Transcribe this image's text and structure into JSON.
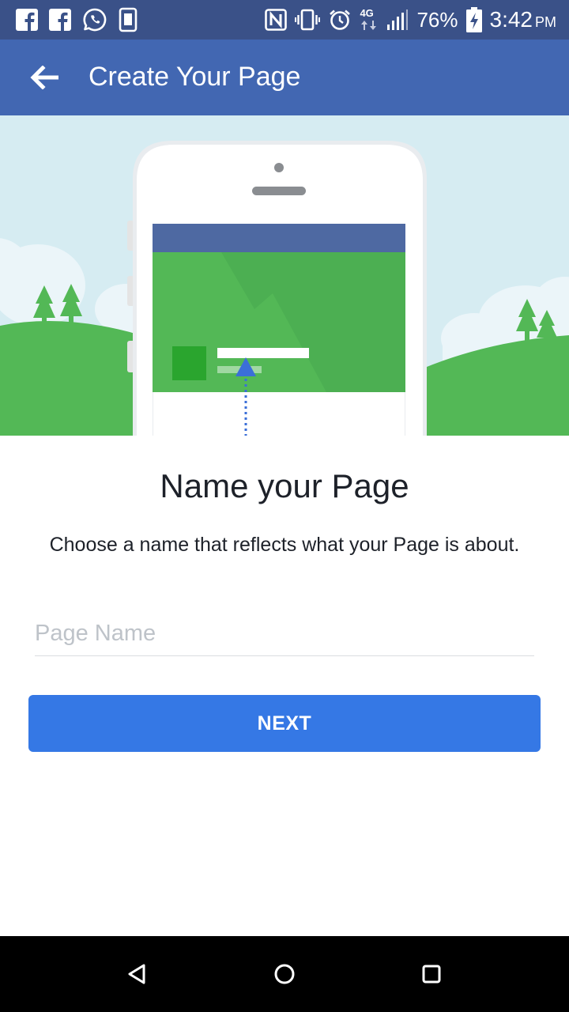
{
  "status_bar": {
    "notification_icons": [
      "facebook-icon",
      "facebook-icon",
      "whatsapp-icon",
      "screenshot-icon"
    ],
    "system_icons": [
      "nfc-icon",
      "vibrate-icon",
      "alarm-icon",
      "network-4g-icon",
      "signal-icon"
    ],
    "network_label": "4G",
    "battery_percent": "76%",
    "battery_icon": "battery-charging-icon",
    "time": "3:42",
    "am_pm": "PM"
  },
  "app_bar": {
    "back_icon": "back-arrow-icon",
    "title": "Create Your Page",
    "color": "#4267b2"
  },
  "main": {
    "heading": "Name your Page",
    "description": "Choose a name that reflects what your Page is about.",
    "page_name_input": {
      "value": "",
      "placeholder": "Page Name"
    },
    "next_button": {
      "label": "NEXT",
      "color": "#3578e5"
    }
  },
  "nav_bar": {
    "buttons": [
      "back-triangle-icon",
      "home-circle-icon",
      "recents-square-icon"
    ]
  }
}
